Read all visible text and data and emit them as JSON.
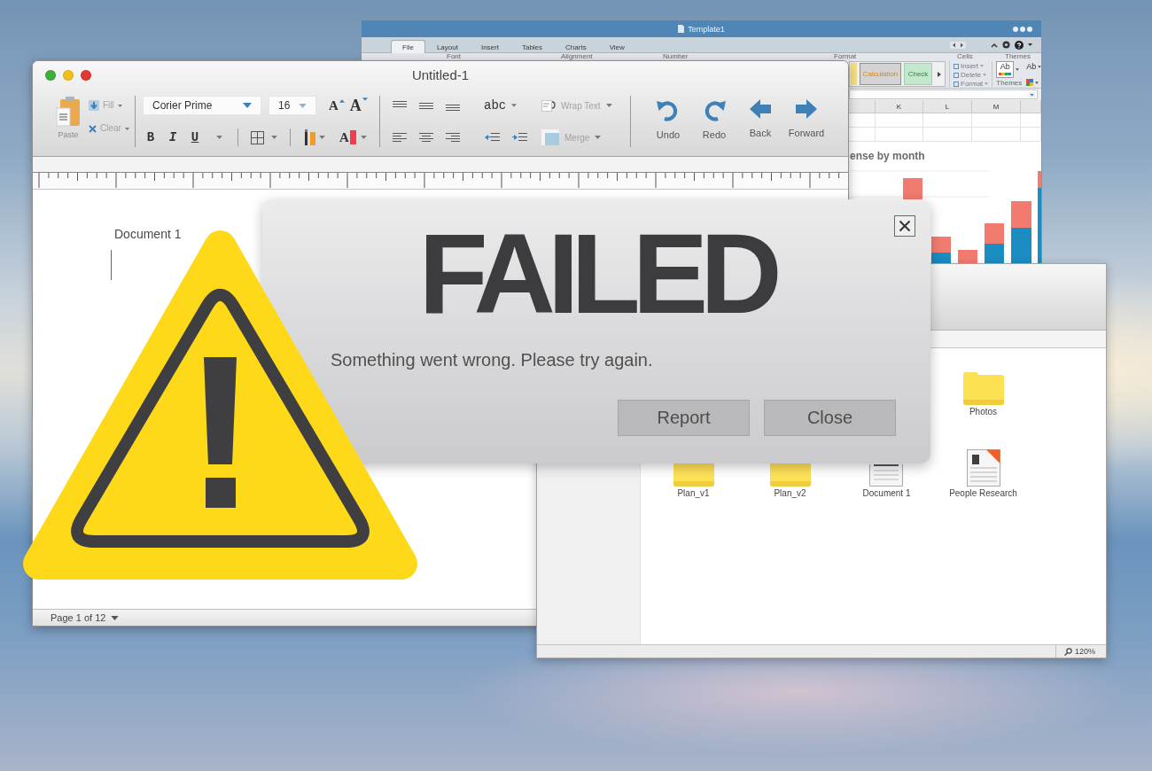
{
  "spreadsheet_window": {
    "title": "Template1",
    "tabs": [
      {
        "label": "File",
        "selected": true
      },
      {
        "label": "Layout",
        "selected": false
      },
      {
        "label": "Insert",
        "selected": false
      },
      {
        "label": "Tables",
        "selected": false
      },
      {
        "label": "Charts",
        "selected": false
      },
      {
        "label": "View",
        "selected": false
      }
    ],
    "ribbon": {
      "group_labels": [
        "Font",
        "Alignment",
        "Number",
        "Format",
        "Cells",
        "Themes"
      ],
      "styles": [
        {
          "label": "Calculation",
          "kind": "calculation"
        },
        {
          "label": "Check",
          "kind": "check"
        }
      ],
      "cell_actions": [
        "Insert",
        "Delete",
        "Format"
      ],
      "theme_button": "Ab",
      "theme_caption": "Themes",
      "theme_fonts": "Ab"
    },
    "columns": [
      "K",
      "L",
      "M"
    ],
    "chart": {
      "title": "ense by month"
    }
  },
  "word_window": {
    "title": "Untitled-1",
    "toolbar": {
      "paste": "Paste",
      "fill": {
        "label": "Fill",
        "disabled": true
      },
      "clear": {
        "label": "Clear",
        "disabled": true
      },
      "font": "Corier Prime",
      "font_size": "16",
      "grow_font": "A",
      "shrink_font": "A",
      "bold": "B",
      "italic": "I",
      "underline": "U",
      "font_color": "A",
      "spelling": "abc",
      "wrap_text": {
        "label": "Wrap Text",
        "disabled": true
      },
      "merge": {
        "label": "Merge",
        "disabled": true
      },
      "history": [
        {
          "label": "Undo",
          "kind": "undo"
        },
        {
          "label": "Redo",
          "kind": "redo"
        },
        {
          "label": "Back",
          "kind": "back"
        },
        {
          "label": "Forward",
          "kind": "forward"
        }
      ]
    },
    "document_title": "Document 1",
    "status": "Page 1 of 12"
  },
  "file_window": {
    "items": [
      {
        "name": "Photos",
        "kind": "folder"
      },
      {
        "name": "Plan_v1",
        "kind": "folder"
      },
      {
        "name": "Plan_v2",
        "kind": "folder"
      },
      {
        "name": "Document 1",
        "kind": "document"
      },
      {
        "name": "People Research",
        "kind": "article"
      }
    ],
    "zoom": "120%"
  },
  "dialog": {
    "title": "FAILED",
    "message": "Something went wrong. Please try again.",
    "buttons": [
      "Report",
      "Close"
    ]
  }
}
